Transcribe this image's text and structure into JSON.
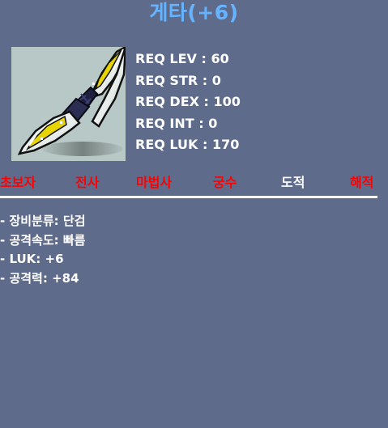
{
  "item": {
    "name": "게타(+6)",
    "colors": {
      "background": "#5e6b8b",
      "title": "#66b3ff",
      "job_available": "#ffffff",
      "job_unavailable": "#ff0000",
      "icon_bg": "#b8c8c6"
    },
    "icon": "dagger-icon"
  },
  "requirements": [
    "REQ LEV : 60",
    "REQ STR : 0",
    "REQ DEX : 100",
    "REQ INT : 0",
    "REQ LUK : 170"
  ],
  "jobs": [
    {
      "label": "초보자",
      "available": false
    },
    {
      "label": "전사",
      "available": false
    },
    {
      "label": "마법사",
      "available": false
    },
    {
      "label": "궁수",
      "available": false
    },
    {
      "label": "도적",
      "available": true
    },
    {
      "label": "해적",
      "available": false
    }
  ],
  "stats": [
    "- 장비분류: 단검",
    "- 공격속도: 빠름",
    "- LUK: +6",
    "- 공격력: +84"
  ]
}
